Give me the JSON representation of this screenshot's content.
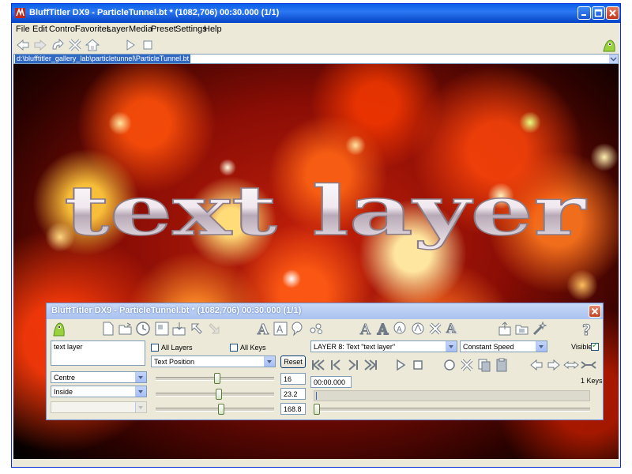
{
  "window": {
    "title": "BluffTitler DX9 - ParticleTunnel.bt * (1082,706) 00:30.000 (1/1)"
  },
  "menu": [
    "File",
    "Edit",
    "Control",
    "Favorites",
    "Layer",
    "Media",
    "Preset",
    "Settings",
    "Help"
  ],
  "toolbar": {
    "icons": [
      "back-icon",
      "forward-icon",
      "redo-icon",
      "stop-icon",
      "home-icon",
      "play-icon",
      "stop-square-icon",
      "bluffy-icon"
    ]
  },
  "path": "d:\\blufftitler_gallery_lab\\particletunnel\\ParticleTunnel.bt",
  "viewport": {
    "text": "text layer"
  },
  "dialog": {
    "title": "BluffTitler DX9 - ParticleTunnel.bt * (1082,706) 00:30.000 (1/1)",
    "text_content": "text layer",
    "all_layers_label": "All Layers",
    "all_keys_label": "All Keys",
    "property_select": "Text Position",
    "reset_label": "Reset",
    "align_select": "Centre",
    "position_select": "Inside",
    "disabled_select": "",
    "layer_select": "LAYER 8: Text \"text layer\"",
    "speed_select": "Constant Speed",
    "visible_label": "Visible",
    "visible_checked": true,
    "values": [
      "16",
      "23.2",
      "168.8"
    ],
    "slider_fractions": [
      0.52,
      0.53,
      0.55
    ],
    "time": "00:00.000",
    "keys": "1 Keys"
  }
}
